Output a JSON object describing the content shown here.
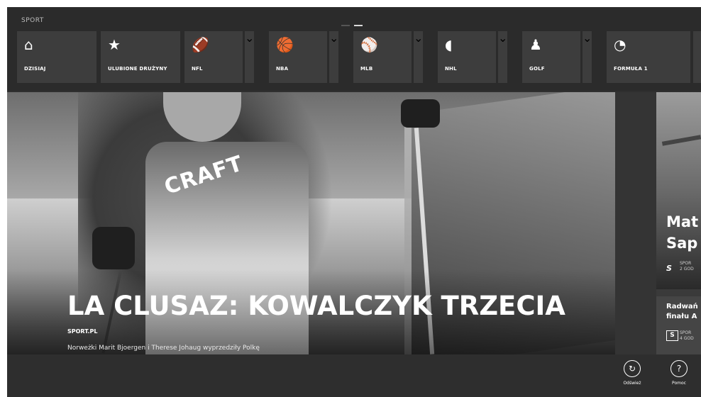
{
  "app": {
    "section_title": "SPORT"
  },
  "nav": {
    "tiles": [
      {
        "label": "DZISIAJ",
        "icon": "home-icon",
        "glyph": "⌂"
      },
      {
        "label": "ULUBIONE DRUŻYNY",
        "icon": "star-icon",
        "glyph": "★"
      },
      {
        "label": "NFL",
        "icon": "football-icon",
        "glyph": "🏈"
      },
      {
        "label": "NBA",
        "icon": "basketball-icon",
        "glyph": "🏀"
      },
      {
        "label": "MLB",
        "icon": "baseball-icon",
        "glyph": "⚾"
      },
      {
        "label": "NHL",
        "icon": "hockey-puck-icon",
        "glyph": "◖"
      },
      {
        "label": "GOLF",
        "icon": "golf-icon",
        "glyph": "♟"
      },
      {
        "label": "FORMUŁA 1",
        "icon": "speedometer-icon",
        "glyph": "◔"
      }
    ],
    "dropdown_glyph": "⌄"
  },
  "hero": {
    "brand_text": "CRAFT",
    "headline": "LA CLUSAZ: KOWALCZYK TRZECIA",
    "source": "SPORT.PL",
    "subtitle": "Norweżki Marit Bjoergen i Therese Johaug wyprzedziły Polkę"
  },
  "side": {
    "story1": {
      "title_line1": "Mat",
      "title_line2": "Sap",
      "source_logo": "S",
      "meta_line1": "SPOR",
      "meta_line2": "2 GOD"
    },
    "story2": {
      "title_line1": "Radwań",
      "title_line2": "finału A",
      "source_logo": "S",
      "meta_line1": "SPOR",
      "meta_line2": "4 GOD"
    }
  },
  "appbar": {
    "refresh_label": "Odśwież",
    "help_label": "Pomoc",
    "refresh_glyph": "↻",
    "help_glyph": "?"
  },
  "colors": {
    "background": "#2f2f2f",
    "tile": "#3d3d3d",
    "text": "#ffffff"
  }
}
